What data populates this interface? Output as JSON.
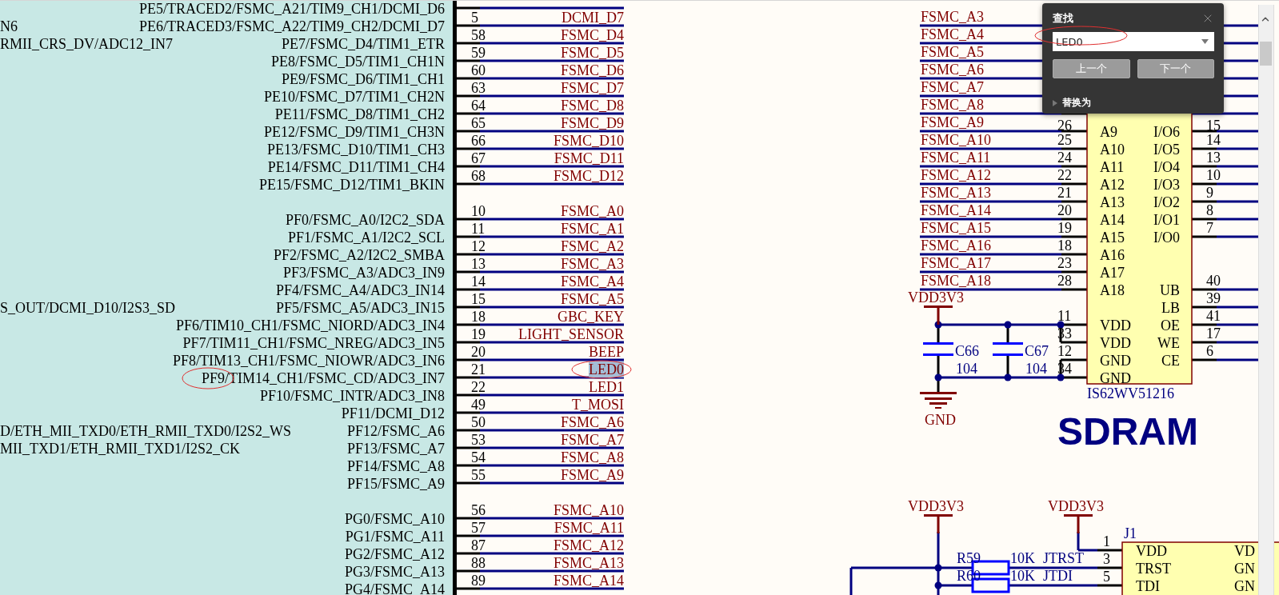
{
  "mcu_pin_groups": [
    [
      {
        "function": "PE5/TRACED2/FSMC_A21/TIM9_CH1/DCMI_D6"
      },
      {
        "pin": "5",
        "net": "DCMI_D7",
        "function": "PE6/TRACED3/FSMC_A22/TIM9_CH2/DCMI_D7",
        "left_text": "N6"
      },
      {
        "pin": "58",
        "net": "FSMC_D4",
        "function": "PE7/FSMC_D4/TIM1_ETR",
        "left_text": "RMII_CRS_DV/ADC12_IN7"
      },
      {
        "pin": "59",
        "net": "FSMC_D5",
        "function": "PE8/FSMC_D5/TIM1_CH1N"
      },
      {
        "pin": "60",
        "net": "FSMC_D6",
        "function": "PE9/FSMC_D6/TIM1_CH1"
      },
      {
        "pin": "63",
        "net": "FSMC_D7",
        "function": "PE10/FSMC_D7/TIM1_CH2N"
      },
      {
        "pin": "64",
        "net": "FSMC_D8",
        "function": "PE11/FSMC_D8/TIM1_CH2"
      },
      {
        "pin": "65",
        "net": "FSMC_D9",
        "function": "PE12/FSMC_D9/TIM1_CH3N"
      },
      {
        "pin": "66",
        "net": "FSMC_D10",
        "function": "PE13/FSMC_D10/TIM1_CH3"
      },
      {
        "pin": "67",
        "net": "FSMC_D11",
        "function": "PE14/FSMC_D11/TIM1_CH4"
      },
      {
        "pin": "68",
        "net": "FSMC_D12",
        "function": "PE15/FSMC_D12/TIM1_BKIN"
      }
    ],
    [
      {
        "pin": "10",
        "net": "FSMC_A0",
        "function": "PF0/FSMC_A0/I2C2_SDA"
      },
      {
        "pin": "11",
        "net": "FSMC_A1",
        "function": "PF1/FSMC_A1/I2C2_SCL"
      },
      {
        "pin": "12",
        "net": "FSMC_A2",
        "function": "PF2/FSMC_A2/I2C2_SMBA"
      },
      {
        "pin": "13",
        "net": "FSMC_A3",
        "function": "PF3/FSMC_A3/ADC3_IN9"
      },
      {
        "pin": "14",
        "net": "FSMC_A4",
        "function": "PF4/FSMC_A4/ADC3_IN14"
      },
      {
        "pin": "15",
        "net": "FSMC_A5",
        "function": "PF5/FSMC_A5/ADC3_IN15",
        "left_text": "S_OUT/DCMI_D10/I2S3_SD"
      },
      {
        "pin": "18",
        "net": "GBC_KEY",
        "function": "PF6/TIM10_CH1/FSMC_NIORD/ADC3_IN4"
      },
      {
        "pin": "19",
        "net": "LIGHT_SENSOR",
        "function": "PF7/TIM11_CH1/FSMC_NREG/ADC3_IN5"
      },
      {
        "pin": "20",
        "net": "BEEP",
        "function": "PF8/TIM13_CH1/FSMC_NIOWR/ADC3_IN6"
      },
      {
        "pin": "21",
        "net": "LED0",
        "function": "PF9/TIM14_CH1/FSMC_CD/ADC3_IN7",
        "highlighted": true,
        "net_circled": true,
        "function_circled": true
      },
      {
        "pin": "22",
        "net": "LED1",
        "function": "PF10/FSMC_INTR/ADC3_IN8"
      },
      {
        "pin": "49",
        "net": "T_MOSI",
        "function": "PF11/DCMI_D12"
      },
      {
        "pin": "50",
        "net": "FSMC_A6",
        "function": "PF12/FSMC_A6",
        "left_text": "D/ETH_MII_TXD0/ETH_RMII_TXD0/I2S2_WS"
      },
      {
        "pin": "53",
        "net": "FSMC_A7",
        "function": "PF13/FSMC_A7",
        "left_text": "MII_TXD1/ETH_RMII_TXD1/I2S2_CK"
      },
      {
        "pin": "54",
        "net": "FSMC_A8",
        "function": "PF14/FSMC_A8"
      },
      {
        "pin": "55",
        "net": "FSMC_A9",
        "function": "PF15/FSMC_A9"
      }
    ],
    [
      {
        "pin": "56",
        "net": "FSMC_A10",
        "function": "PG0/FSMC_A10"
      },
      {
        "pin": "57",
        "net": "FSMC_A11",
        "function": "PG1/FSMC_A11"
      },
      {
        "pin": "87",
        "net": "FSMC_A12",
        "function": "PG2/FSMC_A12"
      },
      {
        "pin": "88",
        "net": "FSMC_A13",
        "function": "PG3/FSMC_A13"
      },
      {
        "pin": "89",
        "net": "FSMC_A14",
        "function": "PG4/FSMC_A14"
      }
    ]
  ],
  "sram": {
    "nets": [
      "FSMC_A3",
      "FSMC_A4",
      "FSMC_A5",
      "FSMC_A6",
      "FSMC_A7",
      "FSMC_A8",
      "FSMC_A9",
      "FSMC_A10",
      "FSMC_A11",
      "FSMC_A12",
      "FSMC_A13",
      "FSMC_A14",
      "FSMC_A15",
      "FSMC_A16",
      "FSMC_A17",
      "FSMC_A18"
    ],
    "part": "IS62WV51216",
    "rows": [
      {
        "left_pin": "26",
        "left_name": "A9",
        "right_name": "I/O6",
        "right_pin": "15"
      },
      {
        "left_pin": "25",
        "left_name": "A10",
        "right_name": "I/O5",
        "right_pin": "14"
      },
      {
        "left_pin": "24",
        "left_name": "A11",
        "right_name": "I/O4",
        "right_pin": "13"
      },
      {
        "left_pin": "22",
        "left_name": "A12",
        "right_name": "I/O3",
        "right_pin": "10"
      },
      {
        "left_pin": "21",
        "left_name": "A13",
        "right_name": "I/O2",
        "right_pin": "9"
      },
      {
        "left_pin": "20",
        "left_name": "A14",
        "right_name": "I/O1",
        "right_pin": "8"
      },
      {
        "left_pin": "19",
        "left_name": "A15",
        "right_name": "I/O0",
        "right_pin": "7"
      },
      {
        "left_pin": "18",
        "left_name": "A16"
      },
      {
        "left_pin": "23",
        "left_name": "A17"
      },
      {
        "left_pin": "28",
        "left_name": "A18",
        "right_name": "UB",
        "right_pin": "40"
      },
      {
        "right_name": "LB",
        "right_pin": "39"
      },
      {
        "left_pin": "11",
        "left_name": "VDD",
        "right_name": "OE",
        "right_pin": "41"
      },
      {
        "left_pin": "33",
        "left_name": "VDD",
        "right_name": "WE",
        "right_pin": "17"
      },
      {
        "left_pin": "12",
        "left_name": "GND",
        "right_name": "CE",
        "right_pin": "6"
      },
      {
        "left_pin": "34",
        "left_name": "GND"
      }
    ]
  },
  "decoupling": {
    "supply": "VDD3V3",
    "ground": "GND",
    "capacitors": [
      {
        "ref": "C66",
        "value": "104"
      },
      {
        "ref": "C67",
        "value": "104"
      }
    ]
  },
  "section_title": "SDRAM",
  "jtag": {
    "supplies": [
      "VDD3V3",
      "VDD3V3"
    ],
    "connector": "J1",
    "pins": [
      {
        "number": "1",
        "name": "VDD",
        "right_name": "VD"
      },
      {
        "number": "3",
        "name": "TRST",
        "right_name": "GN"
      },
      {
        "number": "5",
        "name": "TDI",
        "right_name": "GN"
      }
    ],
    "resistors": [
      {
        "ref": "R59",
        "value": "10K",
        "net": "JTRST"
      },
      {
        "ref": "R60",
        "value": "10K",
        "net": "JTDI"
      }
    ]
  },
  "find_dialog": {
    "title": "查找",
    "query": "LED0",
    "query_circled": true,
    "buttons": [
      "上一个",
      "下一个"
    ],
    "replace_label": "替换为",
    "replace_expanded": false
  }
}
